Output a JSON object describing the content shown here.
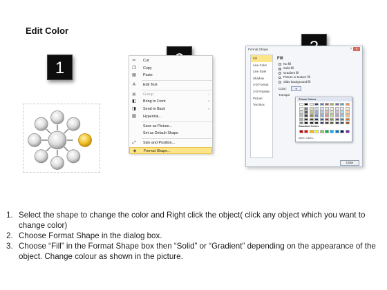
{
  "page": {
    "title": "Edit Color"
  },
  "badges": [
    "1",
    "2",
    "3"
  ],
  "context_menu": {
    "items": [
      {
        "label": "Cut",
        "icon": "scissors-icon",
        "glyph": "✂",
        "arrow": false,
        "disabled": false,
        "highlighted": false
      },
      {
        "label": "Copy",
        "icon": "copy-icon",
        "glyph": "❐",
        "arrow": false,
        "disabled": false,
        "highlighted": false
      },
      {
        "label": "Paste",
        "icon": "paste-icon",
        "glyph": "▤",
        "arrow": false,
        "disabled": false,
        "highlighted": false
      },
      {
        "label": "Edit Text",
        "icon": "edit-text-icon",
        "glyph": "A",
        "arrow": false,
        "disabled": false,
        "highlighted": false
      },
      {
        "label": "Group",
        "icon": "group-icon",
        "glyph": "▣",
        "arrow": true,
        "disabled": true,
        "highlighted": false
      },
      {
        "label": "Bring to Front",
        "icon": "bring-to-front-icon",
        "glyph": "◧",
        "arrow": true,
        "disabled": false,
        "highlighted": false
      },
      {
        "label": "Send to Back",
        "icon": "send-to-back-icon",
        "glyph": "◨",
        "arrow": true,
        "disabled": false,
        "highlighted": false
      },
      {
        "label": "Hyperlink...",
        "icon": "hyperlink-icon",
        "glyph": "⛓",
        "arrow": false,
        "disabled": false,
        "highlighted": false
      },
      {
        "label": "Save as Picture...",
        "icon": "",
        "glyph": "",
        "arrow": false,
        "disabled": false,
        "highlighted": false
      },
      {
        "label": "Set as Default Shape",
        "icon": "",
        "glyph": "",
        "arrow": false,
        "disabled": false,
        "highlighted": false
      },
      {
        "label": "Size and Position...",
        "icon": "size-position-icon",
        "glyph": "⤢",
        "arrow": false,
        "disabled": false,
        "highlighted": false
      },
      {
        "label": "Format Shape...",
        "icon": "format-shape-icon",
        "glyph": "◈",
        "arrow": false,
        "disabled": false,
        "highlighted": true
      }
    ]
  },
  "dialog": {
    "title": "Format Shape",
    "help": "?",
    "close": "✕",
    "nav": [
      "Fill",
      "Line Color",
      "Line Style",
      "Shadow",
      "3-D Format",
      "3-D Rotation",
      "Picture",
      "Text Box"
    ],
    "active_nav": "Fill",
    "fill_heading": "Fill",
    "fill_options": [
      {
        "label": "No fill",
        "selected": false
      },
      {
        "label": "Solid fill",
        "selected": true
      },
      {
        "label": "Gradient fill",
        "selected": false
      },
      {
        "label": "Picture or texture fill",
        "selected": false
      },
      {
        "label": "Slide background fill",
        "selected": false
      }
    ],
    "color_label": "Color:",
    "transparency_label": "Transpa",
    "close_button": "Close"
  },
  "palette": {
    "theme_title": "Theme Colors",
    "standard_title": "Standard Colors",
    "more_colors": "More Colors...",
    "theme_top": [
      "#ffffff",
      "#000000",
      "#eeece1",
      "#1f497d",
      "#4f81bd",
      "#c0504d",
      "#9bbb59",
      "#8064a2",
      "#4bacc6",
      "#f79646"
    ],
    "theme_shades": [
      [
        "#f2f2f2",
        "#7f7f7f",
        "#ddd9c3",
        "#c6d9f0",
        "#dbe5f1",
        "#f2dcdb",
        "#ebf1dd",
        "#e5e0ec",
        "#dbeef3",
        "#fdeada"
      ],
      [
        "#d8d8d8",
        "#595959",
        "#c4bd97",
        "#8db3e2",
        "#b8cce4",
        "#e5b9b7",
        "#d7e3bc",
        "#ccc1d9",
        "#b7dde8",
        "#fbd5b5"
      ],
      [
        "#bfbfbf",
        "#3f3f3f",
        "#938953",
        "#548dd4",
        "#95b3d7",
        "#d99694",
        "#c3d69b",
        "#b2a2c7",
        "#92cddc",
        "#fac08f"
      ],
      [
        "#a5a5a5",
        "#262626",
        "#494429",
        "#17365d",
        "#366092",
        "#953734",
        "#76923c",
        "#5f497a",
        "#31859b",
        "#e36c09"
      ],
      [
        "#7f7f7f",
        "#0c0c0c",
        "#1d1b10",
        "#0f243e",
        "#244061",
        "#632423",
        "#4f6128",
        "#3f3151",
        "#205867",
        "#974806"
      ]
    ],
    "standard": [
      "#c00000",
      "#ff0000",
      "#ffc000",
      "#ffff00",
      "#92d050",
      "#00b050",
      "#00b0f0",
      "#0070c0",
      "#002060",
      "#7030a0"
    ]
  },
  "instructions": [
    {
      "num": "1.",
      "text": "Select the shape to change the color and Right click the object( click any object which you want to change color)"
    },
    {
      "num": "2.",
      "text": "Choose Format Shape in the dialog box."
    },
    {
      "num": "3.",
      "text": "Choose “Fill” in the Format Shape box then “Solid” or “Gradient” depending on the appearance of the object. Change colour as shown in the picture."
    }
  ],
  "colors": {
    "badge_bg": "#0d0d0d",
    "highlight": "#fde58a",
    "selected_circle": "#f2c12e",
    "circle_gray": "#d9d9d9"
  }
}
